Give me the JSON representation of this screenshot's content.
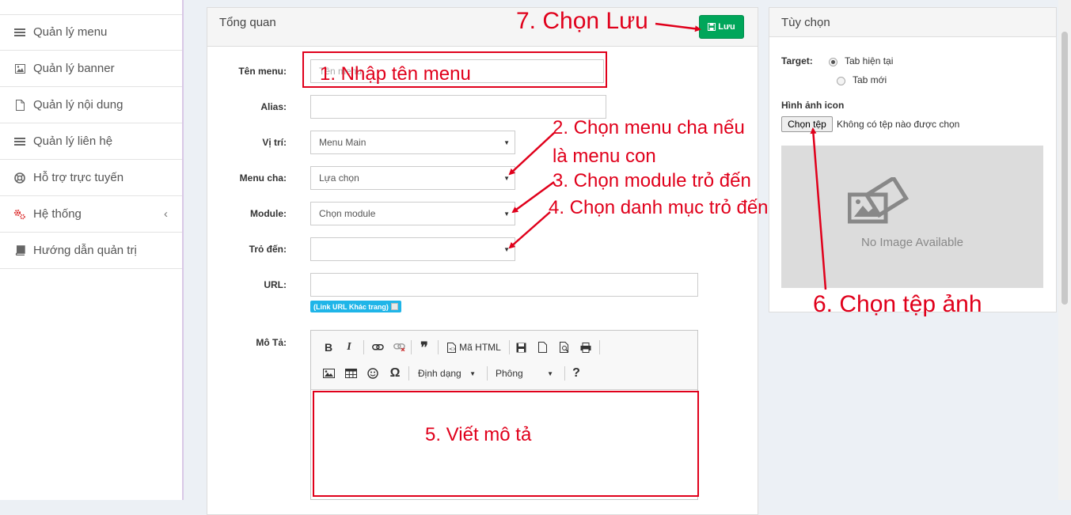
{
  "sidebar": {
    "items": [
      {
        "label": "Quản lý menu",
        "icon": "bars-icon"
      },
      {
        "label": "Quản lý banner",
        "icon": "image-icon"
      },
      {
        "label": "Quản lý nội dung",
        "icon": "file-icon"
      },
      {
        "label": "Quản lý liên hệ",
        "icon": "bars-icon"
      },
      {
        "label": "Hỗ trợ trực tuyến",
        "icon": "lifebuoy-icon"
      },
      {
        "label": "Hệ thống",
        "icon": "cogs-icon",
        "expand": "‹"
      },
      {
        "label": "Hướng dẫn quản trị",
        "icon": "book-icon"
      }
    ]
  },
  "overview": {
    "title": "Tổng quan",
    "save_label": "Lưu",
    "fields": {
      "name_label": "Tên menu:",
      "name_placeholder": "Tên menu",
      "alias_label": "Alias:",
      "position_label": "Vị trí:",
      "position_value": "Menu Main",
      "parent_label": "Menu cha:",
      "parent_value": "Lựa chọn",
      "module_label": "Module:",
      "module_value": "Chọn module",
      "target_label": "Trỏ đến:",
      "url_label": "URL:",
      "link_badge": "(Link URL Khác trang)",
      "desc_label": "Mô Tả:"
    },
    "editor": {
      "html_label": "Mã HTML",
      "format_label": "Định dạng",
      "font_label": "Phông"
    }
  },
  "options": {
    "title": "Tùy chọn",
    "target_label": "Target:",
    "target_current": "Tab hiện tại",
    "target_new": "Tab mới",
    "icon_label": "Hình ảnh icon",
    "file_button": "Chọn tệp",
    "file_status": "Không có tệp nào được chọn",
    "no_image": "No Image Available"
  },
  "annotations": {
    "a1": "1. Nhập tên menu",
    "a2_line1": "2. Chọn menu cha nếu",
    "a2_line2": "là menu con",
    "a3": "3. Chọn module trỏ đến",
    "a4": "4. Chọn danh mục trỏ đến",
    "a5": "5. Viết mô tả",
    "a6": "6. Chọn tệp ảnh",
    "a7": "7. Chọn Lưu"
  },
  "colors": {
    "annotation": "#e0001b",
    "save_button": "#00a65a",
    "link_badge": "#1fb5e8"
  }
}
